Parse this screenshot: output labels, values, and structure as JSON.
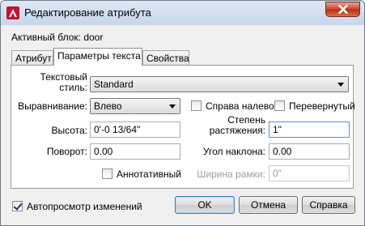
{
  "window": {
    "title": "Редактирование атрибута",
    "close_icon": "close-icon",
    "app_icon": "autocad-logo-icon"
  },
  "block_label": "Активный блок: door",
  "tabs": [
    {
      "label": "Атрибут",
      "active": false
    },
    {
      "label": "Параметры текста",
      "active": true
    },
    {
      "label": "Свойства",
      "active": false
    }
  ],
  "form": {
    "text_style_label": "Текстовый\nстиль:",
    "text_style_value": "Standard",
    "justify_label": "Выравнивание:",
    "justify_value": "Влево",
    "backwards_label": "Справа налево",
    "backwards_checked": false,
    "upside_down_label": "Перевернутый",
    "upside_down_checked": false,
    "height_label": "Высота:",
    "height_value": "0'-0 13/64\"",
    "width_factor_label": "Степень\nрастяжения:",
    "width_factor_value": "1\"",
    "rotation_label": "Поворот:",
    "rotation_value": "0.00",
    "oblique_label": "Угол наклона:",
    "oblique_value": "0.00",
    "annotative_label": "Аннотативный",
    "annotative_checked": false,
    "boundary_width_label": "Ширина рамки:",
    "boundary_width_value": "0\""
  },
  "footer": {
    "autopreview_label": "Автопросмотр изменений",
    "autopreview_checked": true,
    "ok_label": "OK",
    "cancel_label": "Отмена",
    "help_label": "Справка"
  }
}
